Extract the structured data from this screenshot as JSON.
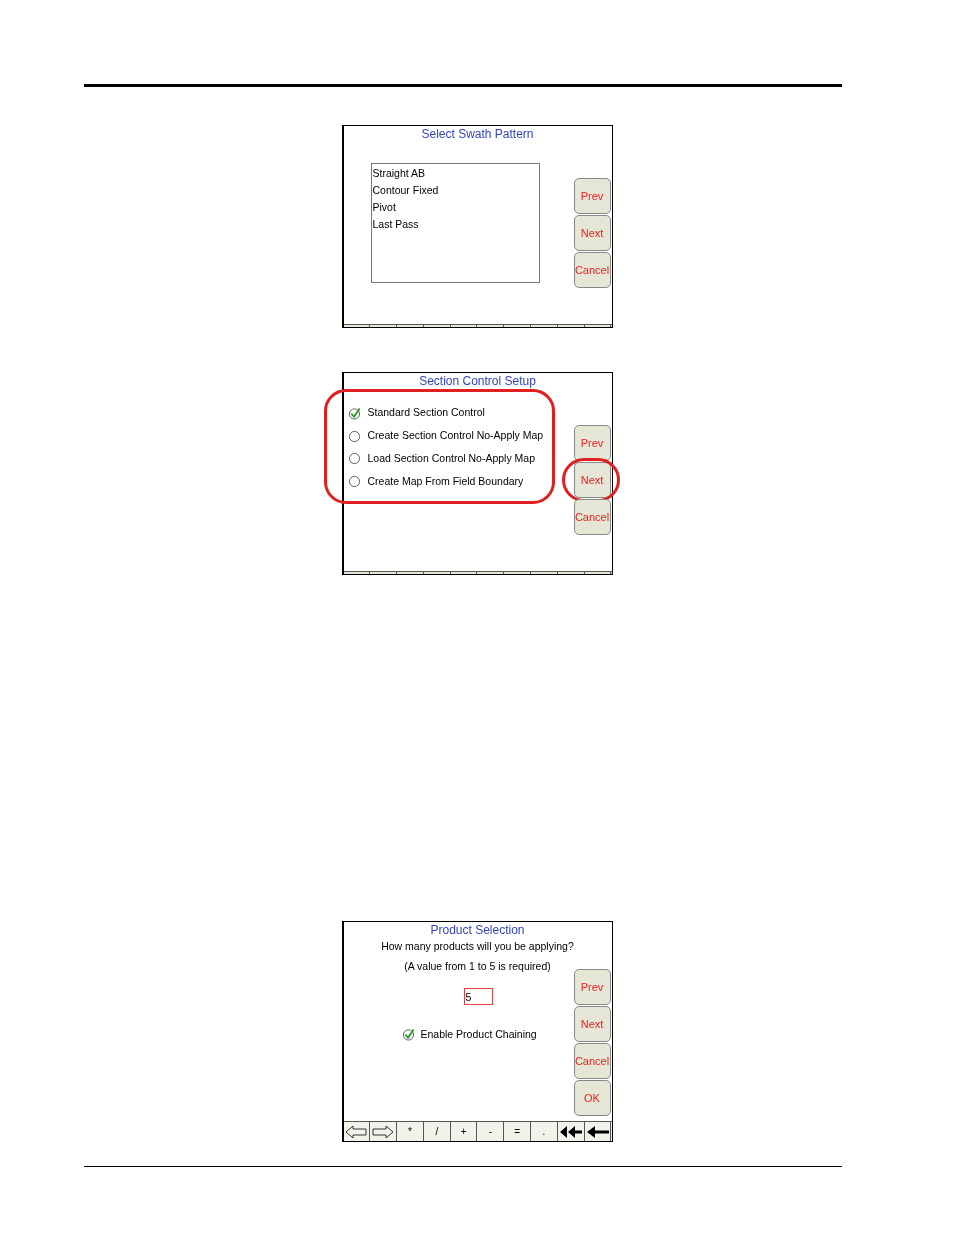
{
  "screens": [
    {
      "kind": "list",
      "title": "Select Swath Pattern",
      "items": [
        "Straight AB",
        "Contour Fixed",
        "Pivot",
        "Last Pass"
      ],
      "buttons": [
        {
          "label": "Prev",
          "highlighted": false
        },
        {
          "label": "Next",
          "highlighted": false
        },
        {
          "label": "Cancel",
          "highlighted": false
        }
      ]
    },
    {
      "kind": "radio",
      "title": "Section Control Setup",
      "options_highlighted": true,
      "options": [
        {
          "label": "Standard Section Control",
          "selected": true
        },
        {
          "label": "Create Section Control No-Apply Map",
          "selected": false
        },
        {
          "label": "Load Section Control No-Apply Map",
          "selected": false
        },
        {
          "label": "Create Map From Field Boundary",
          "selected": false
        }
      ],
      "buttons": [
        {
          "label": "Prev",
          "highlighted": false
        },
        {
          "label": "Next",
          "highlighted": true
        },
        {
          "label": "Cancel",
          "highlighted": false
        }
      ]
    },
    {
      "kind": "form",
      "title": "Product Selection",
      "question": "How many products will you be applying?",
      "hint": "(A value from 1 to 5 is required)",
      "value": "5",
      "checkbox": {
        "label": "Enable Product Chaining",
        "checked": true
      },
      "buttons": [
        {
          "label": "Prev",
          "highlighted": false
        },
        {
          "label": "Next",
          "highlighted": false
        },
        {
          "label": "Cancel",
          "highlighted": false
        },
        {
          "label": "OK",
          "highlighted": false
        }
      ],
      "keys": [
        {
          "kind": "left-arrow"
        },
        {
          "kind": "right-arrow"
        },
        {
          "kind": "text",
          "label": "*"
        },
        {
          "kind": "text",
          "label": "/"
        },
        {
          "kind": "text",
          "label": "+"
        },
        {
          "kind": "text",
          "label": "-"
        },
        {
          "kind": "text",
          "label": "="
        },
        {
          "kind": "text",
          "label": "."
        },
        {
          "kind": "double-arrow"
        },
        {
          "kind": "backspace"
        }
      ]
    }
  ]
}
